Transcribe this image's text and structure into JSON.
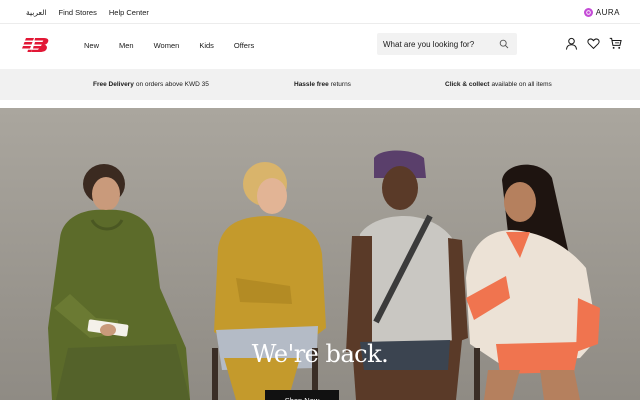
{
  "utility": {
    "links": [
      "العربية",
      "Find Stores",
      "Help Center"
    ],
    "aura_label": "AURA"
  },
  "header": {
    "logo_icon": "new-balance-logo",
    "nav": [
      "New",
      "Men",
      "Women",
      "Kids",
      "Offers"
    ],
    "search_placeholder": "What are you looking for?",
    "icons": [
      "user-icon",
      "heart-icon",
      "cart-icon"
    ]
  },
  "promos": [
    {
      "bold": "Free Delivery",
      "rest": "on orders above KWD 35"
    },
    {
      "bold": "Hassle free",
      "rest": "returns"
    },
    {
      "bold": "Click & collect",
      "rest": "available on all items"
    }
  ],
  "hero": {
    "title": "We're back.",
    "cta": "Shop Now"
  },
  "colors": {
    "brand_red": "#e21836",
    "aura_purple": "#c44bd6",
    "hero_bg": "#a39f97"
  }
}
